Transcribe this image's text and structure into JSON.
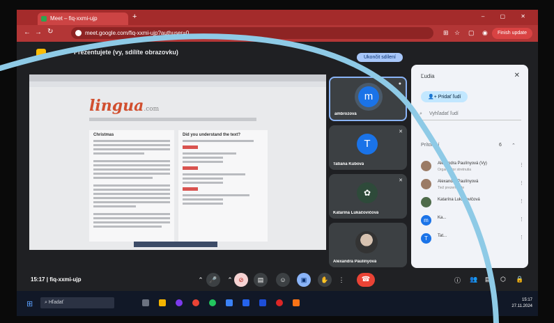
{
  "browser": {
    "tab_title": "Meet – fiq-xxmi-ujp",
    "new_tab": "+",
    "window_controls": "– ▢ ✕",
    "url": "meet.google.com/fiq-xxmi-ujp?authuser=0",
    "back": "←",
    "forward": "→",
    "reload": "↻",
    "update_label": "Finish update"
  },
  "meet": {
    "presenting_text": "Prezentujete (vy, sdílíte obrazovku)",
    "stop_presenting": "Ukončit sdílení",
    "shared_logo": "lingua",
    "shared_logo_suffix": ".com",
    "shared_heading_left": "Christmas",
    "shared_heading_right": "Did you understand the text?",
    "tiles": [
      {
        "name": "ambrozová",
        "initial": "m",
        "color": "#1a73e8",
        "kind": "avatar"
      },
      {
        "name": "Tatiana Kubová",
        "initial": "T",
        "color": "#1a73e8",
        "kind": "avatar"
      },
      {
        "name": "Katarína Lukáčovičová",
        "initial": "",
        "color": "#3c4043",
        "kind": "plant"
      },
      {
        "name": "Alexandra Paulínyová",
        "initial": "",
        "color": "#3c4043",
        "kind": "photo"
      }
    ]
  },
  "people_panel": {
    "title": "Ľudia",
    "close": "✕",
    "add_people": "Pridať ľudí",
    "search_placeholder": "Vyhľadať ľudí",
    "section_label": "Prítomní",
    "section_count": "6",
    "participants": [
      {
        "name": "Alexandra Paulínyová (Vy)",
        "sub": "Organizátor stretnutia",
        "initial": "",
        "color": "#9b7b65"
      },
      {
        "name": "Alexandra Paulínyová",
        "sub": "Tiež prezentujete",
        "initial": "",
        "color": "#9b7b65"
      },
      {
        "name": "Katarína Lukáčovičová",
        "sub": "",
        "initial": "",
        "color": "#4e6b4a"
      },
      {
        "name": "Ka...",
        "sub": "",
        "initial": "m",
        "color": "#1a73e8"
      },
      {
        "name": "Tat...",
        "sub": "",
        "initial": "T",
        "color": "#1a73e8"
      }
    ]
  },
  "bottom_bar": {
    "time": "15:17",
    "separator": "|",
    "meeting_code": "fiq-xxmi-ujp",
    "hangup_icon": "☎"
  },
  "taskbar": {
    "search_placeholder": "Hľadať",
    "clock_time": "15:17",
    "clock_date": "27.11.2024"
  },
  "colors": {
    "browser_bar": "#b33636",
    "meet_bg": "#1f2023",
    "accent_blue": "#8ab4f8",
    "hangup_red": "#ea4335"
  }
}
